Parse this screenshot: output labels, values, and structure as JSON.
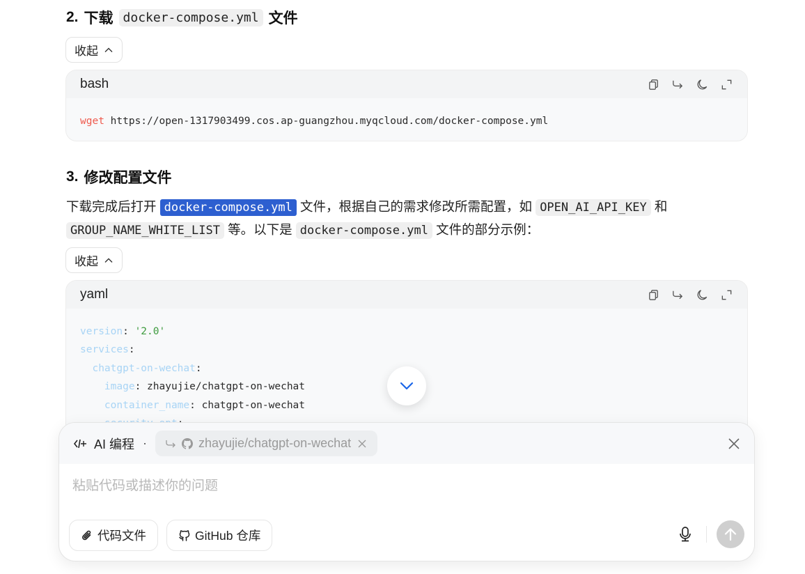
{
  "section2": {
    "number": "2.",
    "title_prefix": "下载",
    "title_code": "docker-compose.yml",
    "title_suffix": "文件",
    "collapse_label": "收起",
    "code": {
      "language": "bash",
      "command": "wget",
      "args": " https://open-1317903499.cos.ap-guangzhou.myqcloud.com/docker-compose.yml"
    }
  },
  "section3": {
    "number": "3.",
    "title": "修改配置文件",
    "para": {
      "t1": "下载完成后打开",
      "c1": "docker-compose.yml",
      "t2": "文件，根据自己的需求修改所需配置，如",
      "c2": "OPEN_AI_API_KEY",
      "t3": "和",
      "c3": "GROUP_NAME_WHITE_LIST",
      "t4": "等。以下是",
      "c4": "docker-compose.yml",
      "t5": "文件的部分示例："
    },
    "collapse_label": "收起",
    "code": {
      "language": "yaml",
      "lines": [
        {
          "indent": "",
          "key": "version",
          "sep": ": ",
          "value": "'2.0'",
          "is_string": true
        },
        {
          "indent": "",
          "key": "services",
          "sep": ":",
          "value": "",
          "is_string": false
        },
        {
          "indent": "  ",
          "key": "chatgpt-on-wechat",
          "sep": ":",
          "value": "",
          "is_string": false
        },
        {
          "indent": "    ",
          "key": "image",
          "sep": ": ",
          "value": "zhayujie/chatgpt-on-wechat",
          "is_string": false
        },
        {
          "indent": "    ",
          "key": "container_name",
          "sep": ": ",
          "value": "chatgpt-on-wechat",
          "is_string": false
        },
        {
          "indent": "    ",
          "key": "security_opt",
          "sep": ":",
          "value": "",
          "is_string": false
        }
      ]
    }
  },
  "code_toolbar": {
    "copy_icon": "copy-icon",
    "wrap_icon": "wrap-arrow-icon",
    "theme_icon": "moon-icon",
    "expand_icon": "expand-icon"
  },
  "composer": {
    "mode_label": "AI 编程",
    "separator": "·",
    "repo_chip": "zhayujie/chatgpt-on-wechat",
    "placeholder": "粘贴代码或描述你的问题",
    "file_button": "代码文件",
    "github_button": "GitHub 仓库"
  },
  "colors": {
    "selection": "#2d5fd0",
    "scroll_chevron": "#1a66e8",
    "send_disabled": "#cfcfcf"
  }
}
